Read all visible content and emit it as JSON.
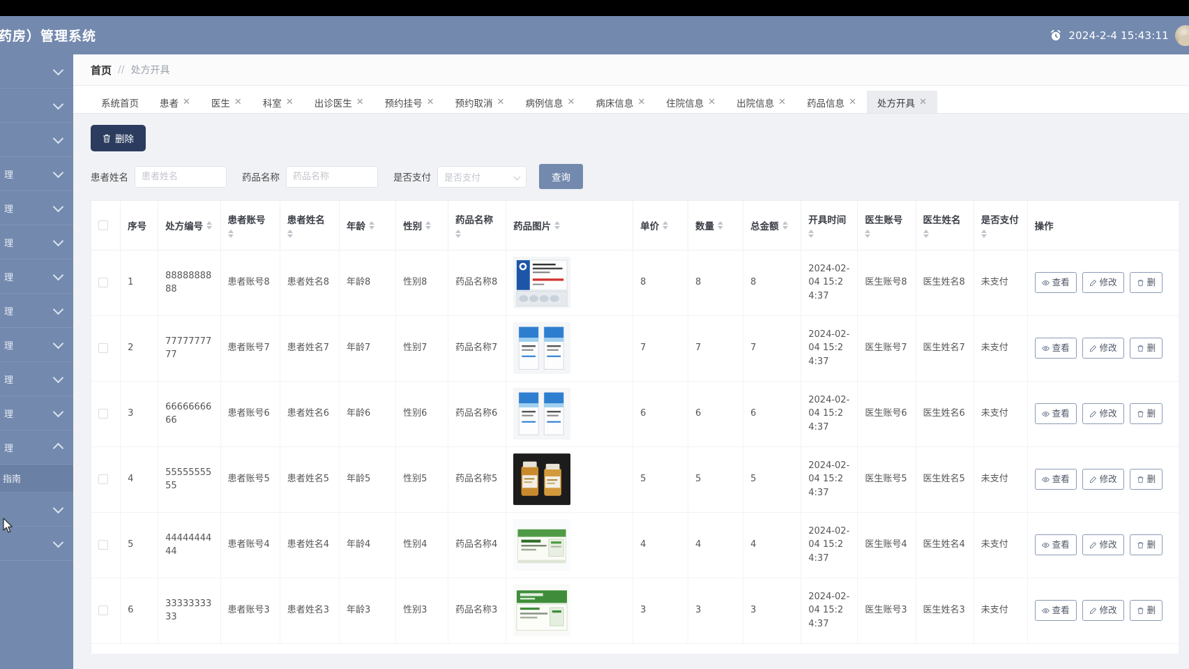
{
  "header": {
    "title": "药房）管理系统",
    "time": "2024-2-4 15:43:11",
    "clock_icon": "alarm-clock-icon",
    "avatar": "user-avatar"
  },
  "sidebar": {
    "items": [
      {
        "label": "",
        "chevron": "down"
      },
      {
        "label": "",
        "chevron": "down"
      },
      {
        "label": "",
        "chevron": "down"
      },
      {
        "label": "理",
        "chevron": "down"
      },
      {
        "label": "理",
        "chevron": "down"
      },
      {
        "label": "理",
        "chevron": "down"
      },
      {
        "label": "理",
        "chevron": "down"
      },
      {
        "label": "理",
        "chevron": "down"
      },
      {
        "label": "理",
        "chevron": "down"
      },
      {
        "label": "理",
        "chevron": "down"
      },
      {
        "label": "理",
        "chevron": "down"
      },
      {
        "label": "理",
        "chevron": "up"
      }
    ],
    "active_sub": "指南",
    "trailing": [
      {
        "label": "",
        "chevron": "down"
      },
      {
        "label": "",
        "chevron": "down"
      }
    ]
  },
  "breadcrumb": {
    "home": "首页",
    "separator": "//",
    "current": "处方开具"
  },
  "tabs": [
    {
      "label": "系统首页",
      "closable": false,
      "active": false
    },
    {
      "label": "患者",
      "closable": true,
      "active": false
    },
    {
      "label": "医生",
      "closable": true,
      "active": false
    },
    {
      "label": "科室",
      "closable": true,
      "active": false
    },
    {
      "label": "出诊医生",
      "closable": true,
      "active": false
    },
    {
      "label": "预约挂号",
      "closable": true,
      "active": false
    },
    {
      "label": "预约取消",
      "closable": true,
      "active": false
    },
    {
      "label": "病例信息",
      "closable": true,
      "active": false
    },
    {
      "label": "病床信息",
      "closable": true,
      "active": false
    },
    {
      "label": "住院信息",
      "closable": true,
      "active": false
    },
    {
      "label": "出院信息",
      "closable": true,
      "active": false
    },
    {
      "label": "药品信息",
      "closable": true,
      "active": false
    },
    {
      "label": "处方开具",
      "closable": true,
      "active": true
    }
  ],
  "toolbar": {
    "delete_label": "删除",
    "delete_icon": "trash-icon"
  },
  "filters": {
    "patient_name_label": "患者姓名",
    "patient_name_placeholder": "患者姓名",
    "patient_name_value": "",
    "drug_name_label": "药品名称",
    "drug_name_placeholder": "药品名称",
    "drug_name_value": "",
    "paid_label": "是否支付",
    "paid_placeholder": "是否支付",
    "paid_value": "",
    "query_label": "查询"
  },
  "table": {
    "columns": [
      {
        "key": "check",
        "label": "",
        "sortable": false
      },
      {
        "key": "index",
        "label": "序号",
        "sortable": false
      },
      {
        "key": "rx_no",
        "label": "处方编号",
        "sortable": true
      },
      {
        "key": "p_acct",
        "label": "患者账号",
        "sortable": true
      },
      {
        "key": "p_name",
        "label": "患者姓名",
        "sortable": true
      },
      {
        "key": "age",
        "label": "年龄",
        "sortable": true
      },
      {
        "key": "gender",
        "label": "性别",
        "sortable": true
      },
      {
        "key": "drug",
        "label": "药品名称",
        "sortable": true
      },
      {
        "key": "image",
        "label": "药品图片",
        "sortable": true
      },
      {
        "key": "price",
        "label": "单价",
        "sortable": true
      },
      {
        "key": "qty",
        "label": "数量",
        "sortable": true
      },
      {
        "key": "total",
        "label": "总金额",
        "sortable": true
      },
      {
        "key": "time",
        "label": "开具时间",
        "sortable": true
      },
      {
        "key": "d_acct",
        "label": "医生账号",
        "sortable": true
      },
      {
        "key": "d_name",
        "label": "医生姓名",
        "sortable": true
      },
      {
        "key": "paid",
        "label": "是否支付",
        "sortable": true
      },
      {
        "key": "ops",
        "label": "操作",
        "sortable": false
      }
    ],
    "rows": [
      {
        "index": "1",
        "rx_no": "8888888888",
        "p_acct": "患者账号8",
        "p_name": "患者姓名8",
        "age": "年龄8",
        "gender": "性别8",
        "drug": "药品名称8",
        "image": "blister-pack-box",
        "price": "8",
        "qty": "8",
        "total": "8",
        "time": "2024-02-04 15:24:37",
        "d_acct": "医生账号8",
        "d_name": "医生姓名8",
        "paid": "未支付"
      },
      {
        "index": "2",
        "rx_no": "7777777777",
        "p_acct": "患者账号7",
        "p_name": "患者姓名7",
        "age": "年龄7",
        "gender": "性别7",
        "drug": "药品名称7",
        "image": "two-cartons",
        "price": "7",
        "qty": "7",
        "total": "7",
        "time": "2024-02-04 15:24:37",
        "d_acct": "医生账号7",
        "d_name": "医生姓名7",
        "paid": "未支付"
      },
      {
        "index": "3",
        "rx_no": "6666666666",
        "p_acct": "患者账号6",
        "p_name": "患者姓名6",
        "age": "年龄6",
        "gender": "性别6",
        "drug": "药品名称6",
        "image": "two-cartons",
        "price": "6",
        "qty": "6",
        "total": "6",
        "time": "2024-02-04 15:24:37",
        "d_acct": "医生账号6",
        "d_name": "医生姓名6",
        "paid": "未支付"
      },
      {
        "index": "4",
        "rx_no": "5555555555",
        "p_acct": "患者账号5",
        "p_name": "患者姓名5",
        "age": "年龄5",
        "gender": "性别5",
        "drug": "药品名称5",
        "image": "amber-bottles",
        "price": "5",
        "qty": "5",
        "total": "5",
        "time": "2024-02-04 15:24:37",
        "d_acct": "医生账号5",
        "d_name": "医生姓名5",
        "paid": "未支付"
      },
      {
        "index": "5",
        "rx_no": "4444444444",
        "p_acct": "患者账号4",
        "p_name": "患者姓名4",
        "age": "年龄4",
        "gender": "性别4",
        "drug": "药品名称4",
        "image": "green-box",
        "price": "4",
        "qty": "4",
        "total": "4",
        "time": "2024-02-04 15:24:37",
        "d_acct": "医生账号4",
        "d_name": "医生姓名4",
        "paid": "未支付"
      },
      {
        "index": "6",
        "rx_no": "3333333333",
        "p_acct": "患者账号3",
        "p_name": "患者姓名3",
        "age": "年龄3",
        "gender": "性别3",
        "drug": "药品名称3",
        "image": "green-box2",
        "price": "3",
        "qty": "3",
        "total": "3",
        "time": "2024-02-04 15:24:37",
        "d_acct": "医生账号3",
        "d_name": "医生姓名3",
        "paid": "未支付"
      }
    ],
    "ops": [
      {
        "label": "查看",
        "icon": "eye-icon"
      },
      {
        "label": "修改",
        "icon": "pencil-icon"
      },
      {
        "label": "删",
        "icon": "trash-icon"
      }
    ]
  },
  "colors": {
    "brand": "#7389ae",
    "dark_button": "#2b3c5e",
    "page_bg": "#f1f2f5"
  }
}
